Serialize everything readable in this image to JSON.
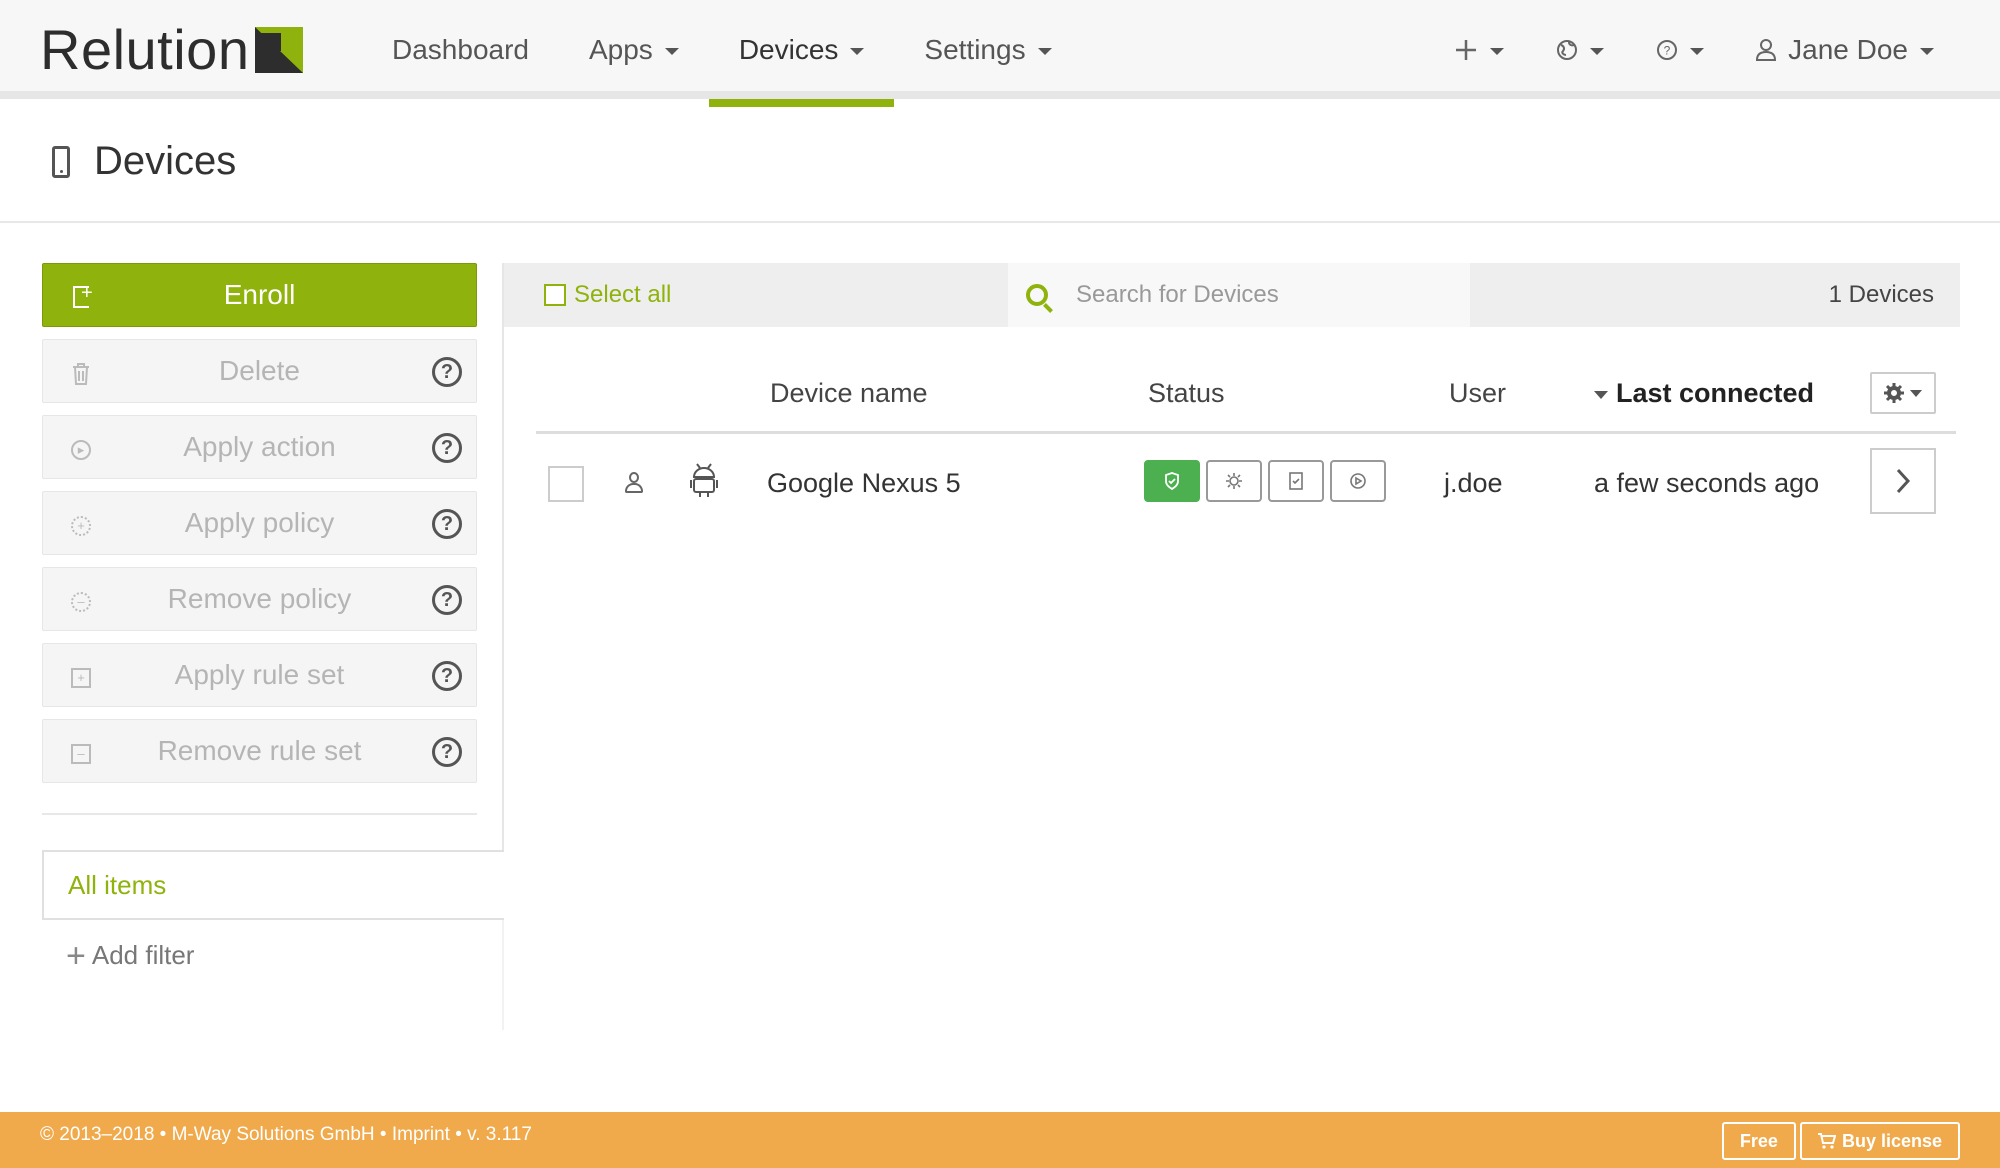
{
  "brand": {
    "name": "Relution",
    "accent": "#8fb30c"
  },
  "nav": {
    "items": [
      {
        "label": "Dashboard",
        "dropdown": false
      },
      {
        "label": "Apps",
        "dropdown": true
      },
      {
        "label": "Devices",
        "dropdown": true,
        "active": true
      },
      {
        "label": "Settings",
        "dropdown": true
      }
    ],
    "user": {
      "name": "Jane Doe"
    }
  },
  "page": {
    "title": "Devices"
  },
  "sidebar": {
    "enroll_label": "Enroll",
    "actions": [
      {
        "label": "Delete",
        "icon": "trash-icon"
      },
      {
        "label": "Apply action",
        "icon": "play-icon"
      },
      {
        "label": "Apply policy",
        "icon": "gear-icon"
      },
      {
        "label": "Remove policy",
        "icon": "gear-icon"
      },
      {
        "label": "Apply rule set",
        "icon": "plus-square-icon"
      },
      {
        "label": "Remove rule set",
        "icon": "minus-square-icon"
      }
    ],
    "filters": {
      "all_items": "All items",
      "add_filter": "Add filter"
    }
  },
  "toolbar": {
    "select_all": "Select all",
    "search_placeholder": "Search for Devices",
    "count": "1 Devices"
  },
  "table": {
    "columns": {
      "name": "Device name",
      "status": "Status",
      "user": "User",
      "last": "Last connected"
    },
    "rows": [
      {
        "name": "Google Nexus 5",
        "user": "j.doe",
        "last": "a few seconds ago",
        "platform": "android-icon",
        "status_ok": "#4caf50"
      }
    ]
  },
  "footer": {
    "text": "© 2013–2018 • M-Way Solutions GmbH • Imprint • v. 3.117",
    "free_label": "Free",
    "buy_label": "Buy license",
    "color": "#f0aa4c"
  }
}
